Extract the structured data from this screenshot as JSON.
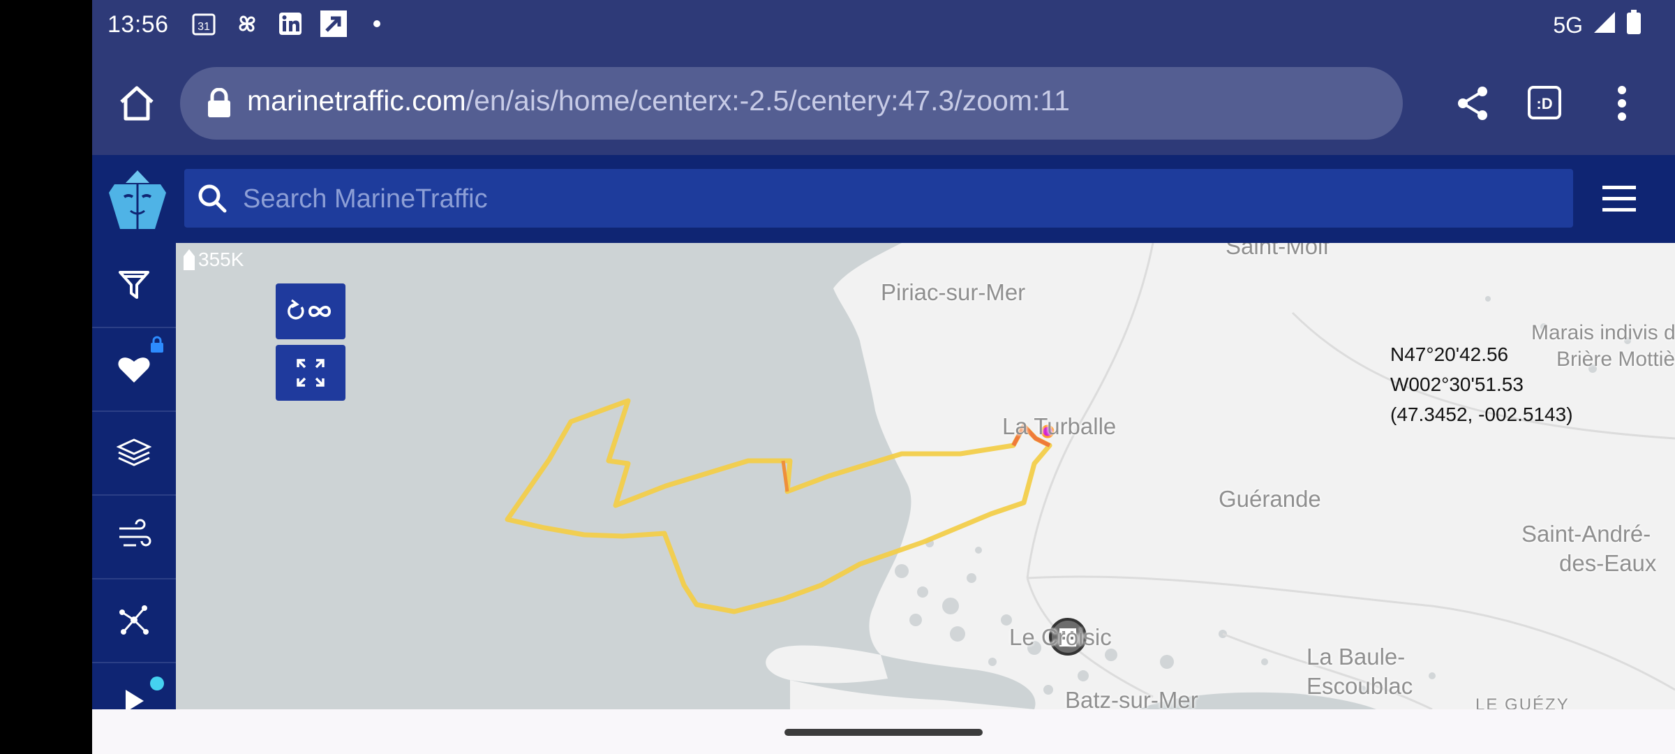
{
  "status_bar": {
    "time": "13:56",
    "calendar_badge": "31",
    "network": "5G",
    "icons": [
      "calendar-icon",
      "pinwheel-icon",
      "linkedin-icon",
      "arrow-icon",
      "dot-icon",
      "signal-icon",
      "battery-icon"
    ]
  },
  "browser": {
    "url_host": "marinetraffic.com",
    "url_path": "/en/ais/home/centerx:-2.5/centery:47.3/zoom:11",
    "tab_label": ":D"
  },
  "app": {
    "search_placeholder": "Search MarineTraffic"
  },
  "sidebar": {
    "items": [
      "filter-icon",
      "heart-icon",
      "layers-icon",
      "wind-icon",
      "network-icon",
      "play-icon"
    ]
  },
  "map": {
    "vessel_count": "355K",
    "places": {
      "saint_molf": "Saint-Molf",
      "piriac": "Piriac-sur-Mer",
      "marais": "Marais indivis de",
      "briere": "Brière Mottière",
      "la_turballe": "La Turballe",
      "guerande": "Guérande",
      "saint_andre": "Saint-André-",
      "des_eaux": "des-Eaux",
      "le_croisic": "Le Croisic",
      "la_baule": "La Baule-",
      "escoublac": "Escoublac",
      "batz": "Batz-sur-Mer",
      "le_guezy": "LE GUÉZY"
    },
    "coords": {
      "lat": "N47°20'42.56",
      "lon": "W002°30'51.53",
      "decimal": "(47.3452, -002.5143)"
    },
    "zoom": {
      "plus": "+",
      "level": "11",
      "minus": "−"
    },
    "colors": {
      "sea": "#cdd3d5",
      "land": "#f2f2f2",
      "track": "#f2c94c",
      "vessel_marker": "#d21fd2",
      "button": "#1f3a9d"
    }
  }
}
